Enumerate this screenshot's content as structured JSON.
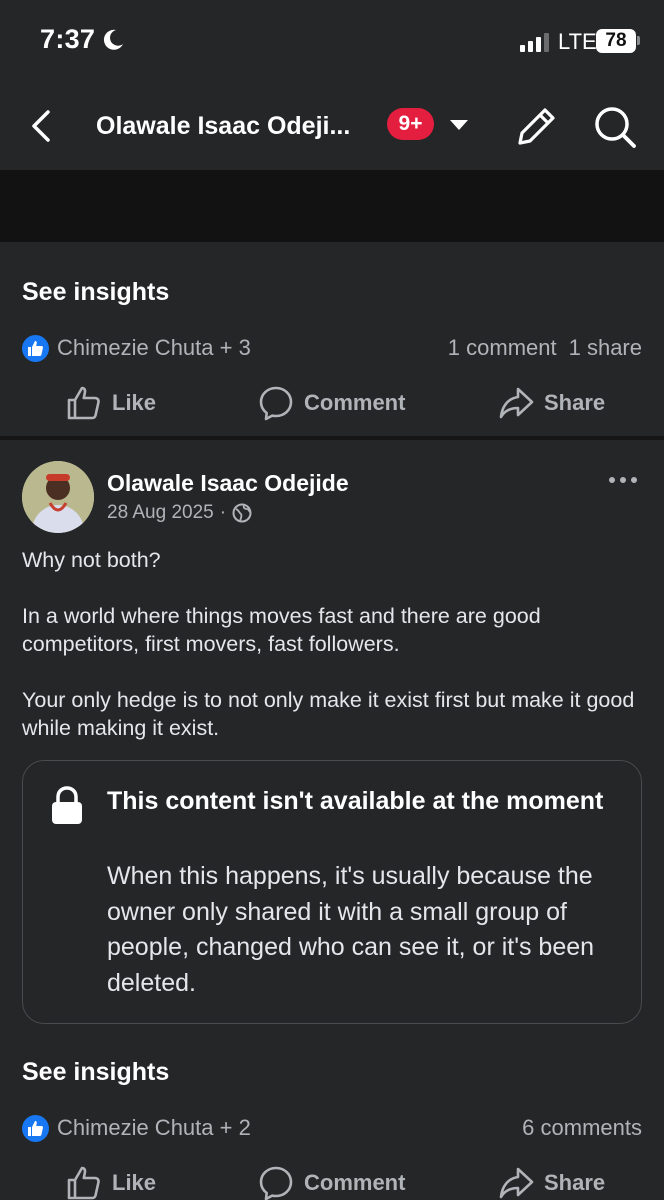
{
  "status_bar": {
    "time": "7:37",
    "network": "LTE",
    "battery": "78"
  },
  "header": {
    "title": "Olawale Isaac Odeji...",
    "badge": "9+"
  },
  "post1": {
    "see_insights": "See insights",
    "reactors": "Chimezie Chuta + 3",
    "comments": "1 comment",
    "shares": "1 share"
  },
  "actions": {
    "like": "Like",
    "comment": "Comment",
    "share": "Share"
  },
  "post2": {
    "author": "Olawale Isaac Odejide",
    "date": "28 Aug 2025",
    "separator": "·",
    "body": [
      "Why not both?",
      "In a world where things moves fast and there are good competitors, first movers, fast followers.",
      "Your only hedge is to not only make it exist first but make it good while making it exist."
    ],
    "unavailable_title": "This content isn't available at the moment",
    "unavailable_text": "When this happens, it's usually because the owner only shared it with a small group of people, changed who can see it, or it's been deleted.",
    "see_insights": "See insights",
    "reactors": "Chimezie Chuta + 2",
    "comments": "6 comments"
  },
  "colors": {
    "accent": "#1877f2",
    "badge": "#e41e3f",
    "background": "#252628"
  }
}
